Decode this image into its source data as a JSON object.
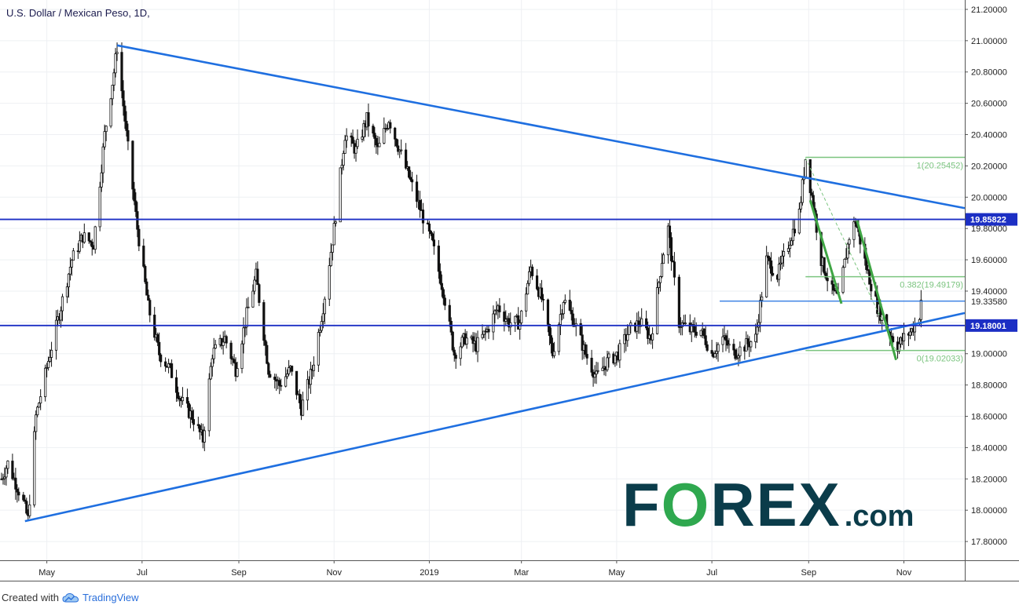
{
  "header": {
    "title": "U.S. Dollar / Mexican Peso, 1D,"
  },
  "footer": {
    "created_with": "Created with",
    "brand": "TradingView"
  },
  "logo": {
    "main_prefix": "F",
    "main_o": "O",
    "main_suffix": "REX",
    "suffix": ".com"
  },
  "colors": {
    "trendline": "#1f6fe0",
    "horizontal_level": "#1c2fc4",
    "fib_line": "#7bc47f",
    "green_wave": "#3fa544",
    "candles": "#111111",
    "logo_text": "#0b3c4a",
    "logo_accent": "#2fa84f"
  },
  "chart_data": {
    "type": "candlestick",
    "symbol": "U.S. Dollar / Mexican Peso",
    "timeframe": "1D",
    "title": "U.S. Dollar / Mexican Peso, 1D,",
    "x_start": "2018-04-01",
    "x_end": "2019-12-10",
    "ylim": [
      17.68,
      21.26
    ],
    "y_ticks": [
      17.8,
      18.0,
      18.2,
      18.4,
      18.6,
      18.8,
      19.0,
      19.2,
      19.4,
      19.6,
      19.8,
      20.0,
      20.2,
      20.4,
      20.6,
      20.8,
      21.0,
      21.2
    ],
    "y_tick_labels": [
      "17.80000",
      "18.00000",
      "18.20000",
      "18.40000",
      "18.60000",
      "18.80000",
      "19.00000",
      "19.20000",
      "19.40000",
      "19.60000",
      "19.80000",
      "20.00000",
      "20.20000",
      "20.40000",
      "20.60000",
      "20.80000",
      "21.00000",
      "21.20000"
    ],
    "x_ticks": [
      {
        "date": "2018-05-01",
        "label": "May"
      },
      {
        "date": "2018-07-01",
        "label": "Jul"
      },
      {
        "date": "2018-09-01",
        "label": "Sep"
      },
      {
        "date": "2018-11-01",
        "label": "Nov"
      },
      {
        "date": "2019-01-01",
        "label": "2019"
      },
      {
        "date": "2019-03-01",
        "label": "Mar"
      },
      {
        "date": "2019-05-01",
        "label": "May"
      },
      {
        "date": "2019-07-01",
        "label": "Jul"
      },
      {
        "date": "2019-09-01",
        "label": "Sep"
      },
      {
        "date": "2019-11-01",
        "label": "Nov"
      }
    ],
    "price_path": [
      {
        "date": "2018-04-02",
        "price": 18.2
      },
      {
        "date": "2018-04-06",
        "price": 18.3
      },
      {
        "date": "2018-04-16",
        "price": 18.05
      },
      {
        "date": "2018-04-19",
        "price": 17.94
      },
      {
        "date": "2018-04-24",
        "price": 18.6
      },
      {
        "date": "2018-05-03",
        "price": 19.0
      },
      {
        "date": "2018-05-10",
        "price": 19.3
      },
      {
        "date": "2018-05-17",
        "price": 19.6
      },
      {
        "date": "2018-05-24",
        "price": 19.75
      },
      {
        "date": "2018-05-31",
        "price": 19.7
      },
      {
        "date": "2018-06-07",
        "price": 20.4
      },
      {
        "date": "2018-06-13",
        "price": 20.8
      },
      {
        "date": "2018-06-15",
        "price": 20.96
      },
      {
        "date": "2018-06-21",
        "price": 20.4
      },
      {
        "date": "2018-06-28",
        "price": 19.8
      },
      {
        "date": "2018-07-05",
        "price": 19.3
      },
      {
        "date": "2018-07-12",
        "price": 19.0
      },
      {
        "date": "2018-07-19",
        "price": 18.9
      },
      {
        "date": "2018-07-26",
        "price": 18.7
      },
      {
        "date": "2018-08-02",
        "price": 18.6
      },
      {
        "date": "2018-08-09",
        "price": 18.45
      },
      {
        "date": "2018-08-15",
        "price": 19.0
      },
      {
        "date": "2018-08-23",
        "price": 19.1
      },
      {
        "date": "2018-08-30",
        "price": 18.9
      },
      {
        "date": "2018-09-06",
        "price": 19.25
      },
      {
        "date": "2018-09-12",
        "price": 19.5
      },
      {
        "date": "2018-09-20",
        "price": 18.9
      },
      {
        "date": "2018-09-27",
        "price": 18.8
      },
      {
        "date": "2018-10-04",
        "price": 18.9
      },
      {
        "date": "2018-10-11",
        "price": 18.65
      },
      {
        "date": "2018-10-18",
        "price": 18.9
      },
      {
        "date": "2018-10-25",
        "price": 19.3
      },
      {
        "date": "2018-11-01",
        "price": 19.8
      },
      {
        "date": "2018-11-08",
        "price": 20.4
      },
      {
        "date": "2018-11-15",
        "price": 20.3
      },
      {
        "date": "2018-11-22",
        "price": 20.5
      },
      {
        "date": "2018-11-29",
        "price": 20.3
      },
      {
        "date": "2018-12-06",
        "price": 20.5
      },
      {
        "date": "2018-12-13",
        "price": 20.3
      },
      {
        "date": "2018-12-20",
        "price": 20.1
      },
      {
        "date": "2018-12-27",
        "price": 19.9
      },
      {
        "date": "2019-01-03",
        "price": 19.7
      },
      {
        "date": "2019-01-10",
        "price": 19.4
      },
      {
        "date": "2019-01-17",
        "price": 19.0
      },
      {
        "date": "2019-01-24",
        "price": 19.1
      },
      {
        "date": "2019-01-31",
        "price": 19.05
      },
      {
        "date": "2019-02-07",
        "price": 19.15
      },
      {
        "date": "2019-02-14",
        "price": 19.3
      },
      {
        "date": "2019-02-21",
        "price": 19.2
      },
      {
        "date": "2019-02-28",
        "price": 19.2
      },
      {
        "date": "2019-03-07",
        "price": 19.55
      },
      {
        "date": "2019-03-14",
        "price": 19.35
      },
      {
        "date": "2019-03-21",
        "price": 19.0
      },
      {
        "date": "2019-03-28",
        "price": 19.35
      },
      {
        "date": "2019-04-04",
        "price": 19.2
      },
      {
        "date": "2019-04-11",
        "price": 19.0
      },
      {
        "date": "2019-04-18",
        "price": 18.85
      },
      {
        "date": "2019-04-25",
        "price": 18.95
      },
      {
        "date": "2019-05-02",
        "price": 19.0
      },
      {
        "date": "2019-05-09",
        "price": 19.15
      },
      {
        "date": "2019-05-16",
        "price": 19.2
      },
      {
        "date": "2019-05-23",
        "price": 19.1
      },
      {
        "date": "2019-05-30",
        "price": 19.6
      },
      {
        "date": "2019-06-03",
        "price": 19.8
      },
      {
        "date": "2019-06-10",
        "price": 19.2
      },
      {
        "date": "2019-06-17",
        "price": 19.15
      },
      {
        "date": "2019-06-24",
        "price": 19.15
      },
      {
        "date": "2019-07-01",
        "price": 19.0
      },
      {
        "date": "2019-07-08",
        "price": 19.1
      },
      {
        "date": "2019-07-15",
        "price": 19.0
      },
      {
        "date": "2019-07-22",
        "price": 19.05
      },
      {
        "date": "2019-07-29",
        "price": 19.1
      },
      {
        "date": "2019-08-05",
        "price": 19.6
      },
      {
        "date": "2019-08-12",
        "price": 19.5
      },
      {
        "date": "2019-08-19",
        "price": 19.7
      },
      {
        "date": "2019-08-26",
        "price": 19.9
      },
      {
        "date": "2019-08-30",
        "price": 20.25
      },
      {
        "date": "2019-09-04",
        "price": 19.95
      },
      {
        "date": "2019-09-09",
        "price": 19.6
      },
      {
        "date": "2019-09-16",
        "price": 19.4
      },
      {
        "date": "2019-09-20",
        "price": 19.35
      },
      {
        "date": "2019-09-27",
        "price": 19.75
      },
      {
        "date": "2019-10-01",
        "price": 19.85
      },
      {
        "date": "2019-10-08",
        "price": 19.55
      },
      {
        "date": "2019-10-15",
        "price": 19.3
      },
      {
        "date": "2019-10-22",
        "price": 19.15
      },
      {
        "date": "2019-10-28",
        "price": 19.05
      },
      {
        "date": "2019-11-01",
        "price": 19.1
      },
      {
        "date": "2019-11-06",
        "price": 19.15
      },
      {
        "date": "2019-11-11",
        "price": 19.25
      },
      {
        "date": "2019-11-12",
        "price": 19.35
      }
    ],
    "trendlines": [
      {
        "name": "upper-trendline",
        "from": {
          "date": "2018-06-15",
          "price": 20.97
        },
        "to": {
          "date": "2019-12-10",
          "price": 19.93
        }
      },
      {
        "name": "lower-trendline",
        "from": {
          "date": "2018-04-17",
          "price": 17.93
        },
        "to": {
          "date": "2019-12-10",
          "price": 19.26
        }
      }
    ],
    "horizontal_levels": [
      {
        "price": 19.85822,
        "label": "19.85822"
      },
      {
        "price": 19.18001,
        "label": "19.18001"
      }
    ],
    "annotation_levels": [
      {
        "price": 19.3358,
        "label": "19.33580",
        "from": "2019-07-06"
      }
    ],
    "fibonacci": {
      "from_date": "2019-08-30",
      "to_date": "2019-12-10",
      "levels": [
        {
          "ratio": 1,
          "price": 20.25452,
          "label": "1(20.25452)"
        },
        {
          "ratio": 0.382,
          "price": 19.49179,
          "label": "0.382(19.49179)"
        },
        {
          "ratio": 0,
          "price": 19.02033,
          "label": "0(19.02033)"
        }
      ]
    },
    "green_wave_lines": [
      {
        "from": {
          "date": "2019-09-02",
          "price": 19.98
        },
        "to": {
          "date": "2019-09-22",
          "price": 19.32
        }
      },
      {
        "from": {
          "date": "2019-10-02",
          "price": 19.85
        },
        "to": {
          "date": "2019-10-27",
          "price": 18.96
        }
      }
    ],
    "fib_trend_dashed": {
      "from": {
        "date": "2019-08-30",
        "price": 20.25
      },
      "to": {
        "date": "2019-10-27",
        "price": 19.02
      }
    },
    "grid": true,
    "legend": "none"
  }
}
